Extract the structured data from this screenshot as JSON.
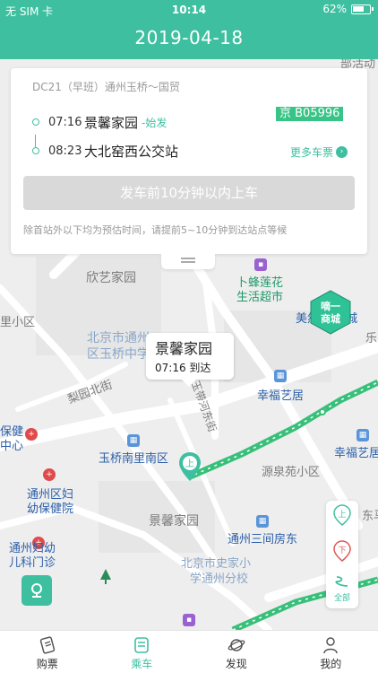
{
  "status_bar": {
    "carrier": "无 SIM 卡",
    "time": "10:14",
    "battery": "62%"
  },
  "header": {
    "title": "2019-04-18"
  },
  "card": {
    "route": "DC21（早班）通州玉桥～国贸",
    "origin_time": "07:16",
    "origin_name": "景馨家园",
    "origin_tag": "-始发",
    "dest_time": "08:23",
    "dest_name": "大北窑西公交站",
    "plate": "京 B05996",
    "more_label": "更多车票",
    "board_button": "发车前10分钟以内上车",
    "note": "除首站外以下均为预估时间，请提前5~10分钟到达站点等候"
  },
  "map": {
    "labels": {
      "l1": "部活动",
      "l2": "欣艺家园",
      "l3": "卜蜂莲花",
      "l4": "生活超市",
      "l5": "里小区",
      "l6": "美然·百度城",
      "l7": "北京市通州",
      "l8": "区玉桥中学",
      "l9": "梨园北街",
      "l10": "幸福艺居",
      "l11": "保健",
      "l12": "中心",
      "l13": "玉桥南里南区",
      "l14": "幸福艺居",
      "l15": "源泉苑小区",
      "l16": "通州区妇",
      "l17": "幼保健院",
      "l18": "景馨家园",
      "l19": "东马",
      "l20": "通州三间房东",
      "l21": "通州妇幼",
      "l22": "儿科门诊",
      "l23": "北京市史家小",
      "l24": "学通州分校",
      "l25": "玉带河东街",
      "l26": "乐"
    },
    "stop_popup": {
      "name": "景馨家园",
      "eta": "07:16 到达"
    },
    "mall_badge": {
      "line1": "嘀一",
      "line2": "商城"
    },
    "side_panel": {
      "up_label": "上",
      "down_label": "下",
      "all_label": "全部"
    },
    "pin_label": "上"
  },
  "tabbar": {
    "tabs": [
      {
        "label": "购票",
        "active": false
      },
      {
        "label": "乘车",
        "active": true
      },
      {
        "label": "发现",
        "active": false
      },
      {
        "label": "我的",
        "active": false
      }
    ]
  },
  "colors": {
    "accent": "#3ec0a0",
    "plate": "#39c487"
  }
}
